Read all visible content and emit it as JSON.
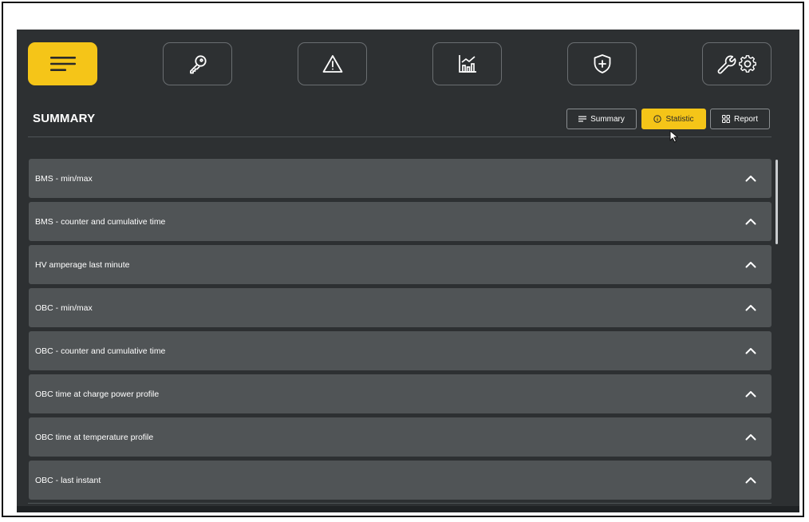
{
  "nav": {
    "buttons": [
      {
        "icon": "menu-icon",
        "active": true
      },
      {
        "icon": "key-icon",
        "active": false
      },
      {
        "icon": "warning-icon",
        "active": false
      },
      {
        "icon": "chart-icon",
        "active": false
      },
      {
        "icon": "shield-plus-icon",
        "active": false
      },
      {
        "icon": "wrench-gear-icon",
        "active": false
      }
    ]
  },
  "header": {
    "title": "SUMMARY",
    "view_buttons": [
      {
        "label": "Summary",
        "icon": "lines-icon",
        "active": false
      },
      {
        "label": "Statistic",
        "icon": "info-icon",
        "active": true
      },
      {
        "label": "Report",
        "icon": "grid-icon",
        "active": false
      }
    ]
  },
  "sections": [
    {
      "label": "BMS - min/max"
    },
    {
      "label": "BMS - counter and cumulative time"
    },
    {
      "label": "HV amperage last minute"
    },
    {
      "label": "OBC - min/max"
    },
    {
      "label": "OBC - counter and cumulative time"
    },
    {
      "label": "OBC time at charge power profile"
    },
    {
      "label": "OBC time at temperature profile"
    },
    {
      "label": "OBC - last instant"
    }
  ],
  "colors": {
    "accent": "#f5c518",
    "panel_bg": "#2d3032",
    "row_bg": "#505456"
  }
}
